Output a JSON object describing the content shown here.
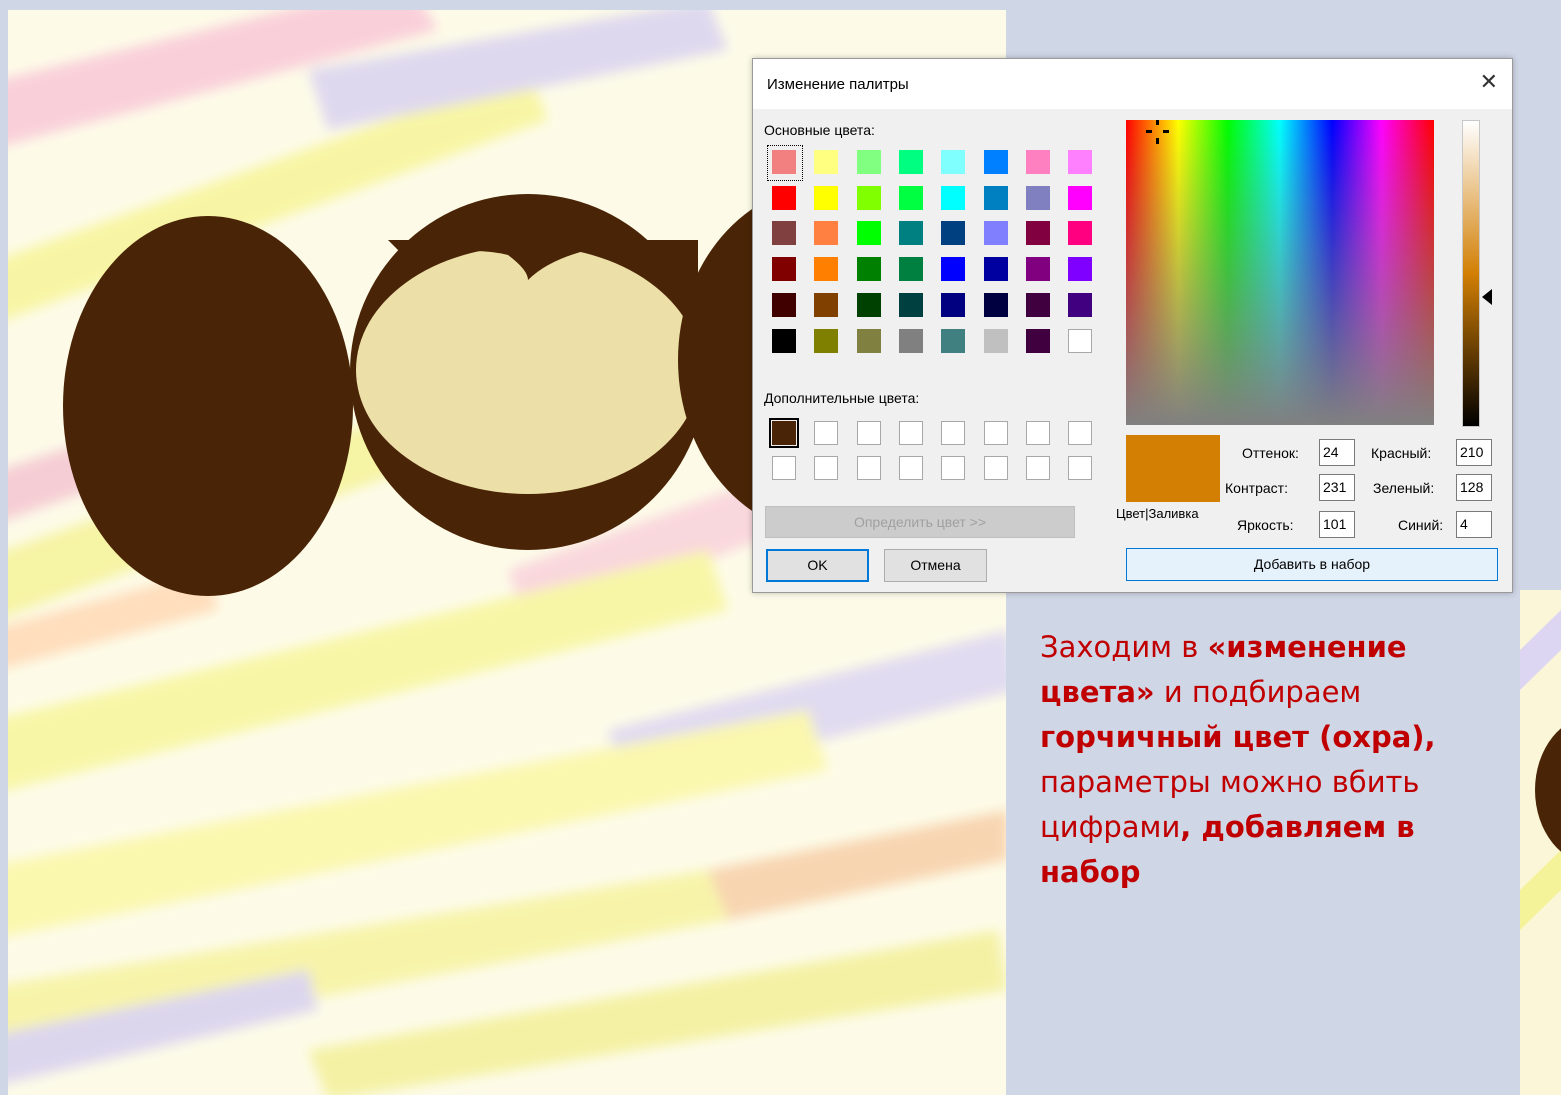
{
  "dialog": {
    "title": "Изменение палитры",
    "close_glyph": "✕",
    "basic_colors_label": "Основные цвета:",
    "basic_colors": [
      [
        "#f28080",
        "#ffff80",
        "#80ff80",
        "#00ff80",
        "#80ffff",
        "#0080ff",
        "#ff80c0",
        "#ff80ff"
      ],
      [
        "#ff0000",
        "#ffff00",
        "#80ff00",
        "#00ff40",
        "#00ffff",
        "#0080c0",
        "#8080c0",
        "#ff00ff"
      ],
      [
        "#804040",
        "#ff8040",
        "#00ff00",
        "#008080",
        "#004080",
        "#8080ff",
        "#800040",
        "#ff0080"
      ],
      [
        "#800000",
        "#ff8000",
        "#008000",
        "#008040",
        "#0000ff",
        "#0000a0",
        "#800080",
        "#8000ff"
      ],
      [
        "#400000",
        "#804000",
        "#004000",
        "#004040",
        "#000080",
        "#000040",
        "#400040",
        "#400080"
      ],
      [
        "#000000",
        "#808000",
        "#808040",
        "#808080",
        "#408080",
        "#c0c0c0",
        "#400040",
        "#ffffff"
      ]
    ],
    "custom_colors_label": "Дополнительные цвета:",
    "custom_first_color": "#4a2406",
    "define_button": "Определить цвет >>",
    "ok_button": "OK",
    "cancel_button": "Отмена",
    "preview_color": "#d27f04",
    "color_fill_label": "Цвет|Заливка",
    "hue_label": "Оттенок:",
    "hue_value": "24",
    "sat_label": "Контраст:",
    "sat_value": "231",
    "lum_label": "Яркость:",
    "lum_value": "101",
    "red_label": "Красный:",
    "red_value": "210",
    "green_label": "Зеленый:",
    "green_value": "128",
    "blue_label": "Синий:",
    "blue_value": "4",
    "add_button": "Добавить в набор",
    "crosshair_icon": "crosshair-icon",
    "luminance_arrow_icon": "triangle-left-icon"
  },
  "instruction": {
    "p1": "Заходим в ",
    "b1": "«изменение цвета»",
    "p2": " и подбираем ",
    "b2": "горчичный цвет (охра),",
    "p3": " параметры можно вбить цифрами",
    "p4": ", ",
    "b3": "добавляем в набор"
  },
  "artwork": {
    "dark_brown": "#4a2406",
    "cream": "#ece0a8"
  }
}
